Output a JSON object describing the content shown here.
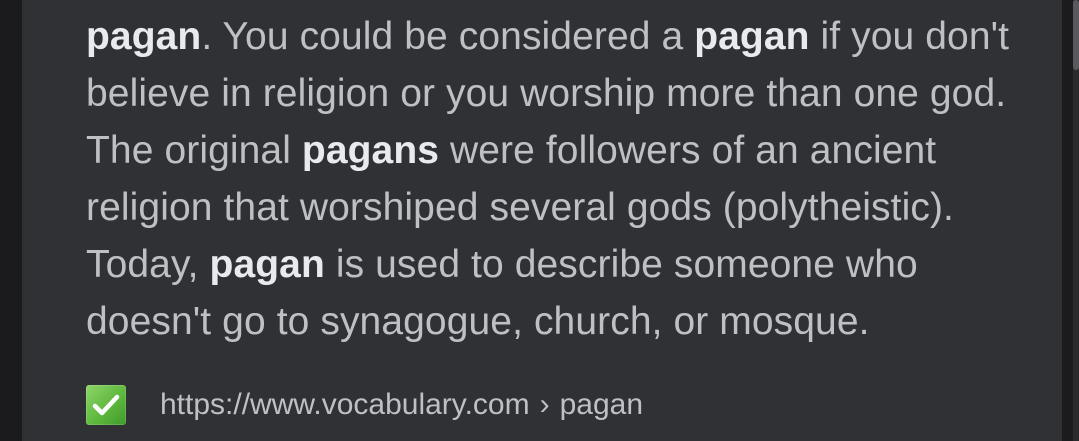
{
  "snippet": {
    "line1": {
      "b1": "pagan",
      "t1": ". You could be considered a ",
      "b2": "pagan",
      "t2": " if you don't"
    },
    "line2": "believe in religion or you worship more than one god.",
    "line3": {
      "t1": "The original ",
      "b1": "pagans",
      "t2": " were followers of an ancient"
    },
    "line4": "religion that worshiped several gods (polytheistic).",
    "line5": {
      "t1": "Today, ",
      "b1": "pagan",
      "t2": " is used to describe someone who"
    },
    "line6": "doesn't go to synagogue, church, or mosque."
  },
  "source": {
    "icon": "green-checkmark-icon",
    "url": "https://www.vocabulary.com",
    "separator": "›",
    "path": "pagan"
  },
  "colors": {
    "background": "#1b1b1d",
    "card": "#303134",
    "text": "#bdc1c6",
    "bold_text": "#e8eaed",
    "check_green": "#5fb83e"
  }
}
